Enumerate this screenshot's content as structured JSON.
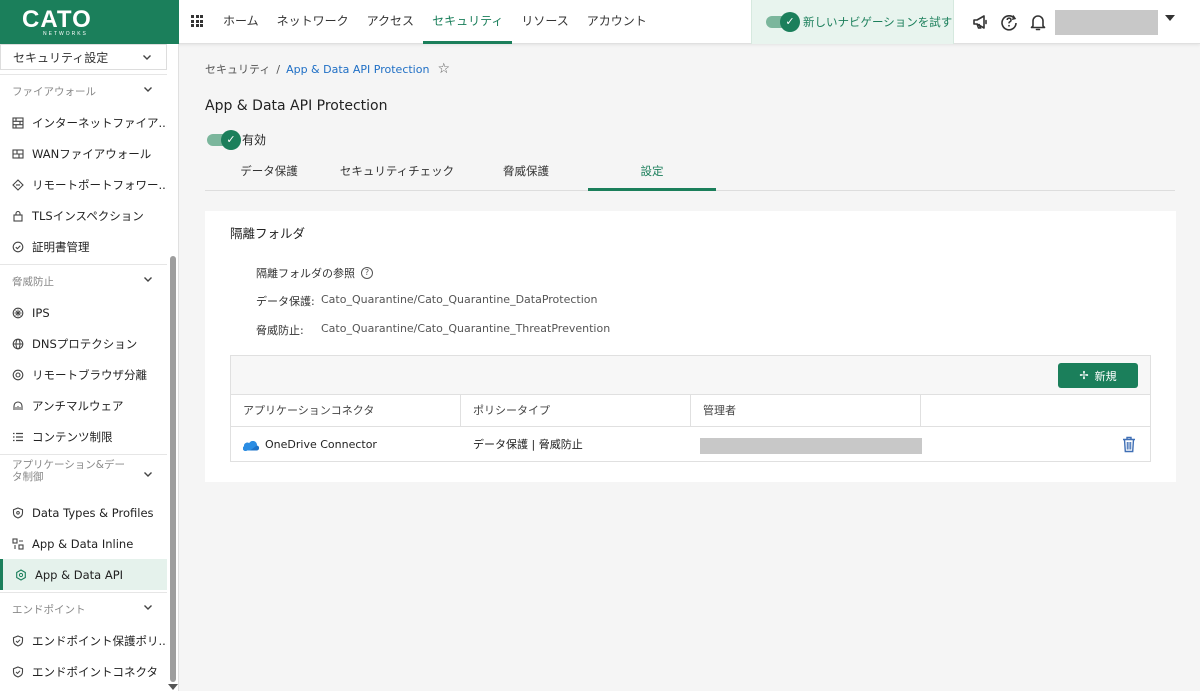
{
  "brand": {
    "logo_text": "CATO",
    "logo_sub": "NETWORKS",
    "accent": "#1b7f5b"
  },
  "topnav": {
    "items": [
      {
        "label": "ホーム"
      },
      {
        "label": "ネットワーク"
      },
      {
        "label": "アクセス"
      },
      {
        "label": "セキュリティ",
        "active": true
      },
      {
        "label": "リソース"
      },
      {
        "label": "アカウント"
      }
    ],
    "new_nav_label": "新しいナビゲーションを試す"
  },
  "sidebar": {
    "select_label": "セキュリティ設定",
    "sections": {
      "firewall": "ファイアウォール",
      "threat": "脅威防止",
      "appdata": "アプリケーション&データ制御",
      "endpoint": "エンドポイント"
    },
    "items": {
      "internet_fw": "インターネットファイア...",
      "wan_fw": "WANファイアウォール",
      "remote_port": "リモートポートフォワー...",
      "tls": "TLSインスペクション",
      "cert": "証明書管理",
      "ips": "IPS",
      "dns": "DNSプロテクション",
      "rbi": "リモートブラウザ分離",
      "antimalware": "アンチマルウェア",
      "content": "コンテンツ制限",
      "data_types": "Data Types & Profiles",
      "app_inline": "App & Data Inline",
      "app_api": "App & Data API",
      "ep_protect": "エンドポイント保護ポリ...",
      "ep_connector": "エンドポイントコネクタ"
    }
  },
  "breadcrumb": {
    "parent": "セキュリティ",
    "separator": "/",
    "current": "App & Data API Protection"
  },
  "page": {
    "title": "App & Data API Protection",
    "enabled_label": "有効"
  },
  "tabs": [
    {
      "label": "データ保護"
    },
    {
      "label": "セキュリティチェック"
    },
    {
      "label": "脅威保護"
    },
    {
      "label": "設定",
      "active": true
    }
  ],
  "quarantine": {
    "title": "隔離フォルダ",
    "ref_label": "隔離フォルダの参照",
    "data_protection_label": "データ保護:",
    "data_protection_value": "Cato_Quarantine/Cato_Quarantine_DataProtection",
    "threat_label": "脅威防止:",
    "threat_value": "Cato_Quarantine/Cato_Quarantine_ThreatPrevention"
  },
  "table": {
    "new_button": "新規",
    "headers": [
      "アプリケーションコネクタ",
      "ポリシータイプ",
      "管理者",
      ""
    ],
    "rows": [
      {
        "connector": "OneDrive Connector",
        "policy_type": "データ保護 | 脅威防止"
      }
    ]
  }
}
